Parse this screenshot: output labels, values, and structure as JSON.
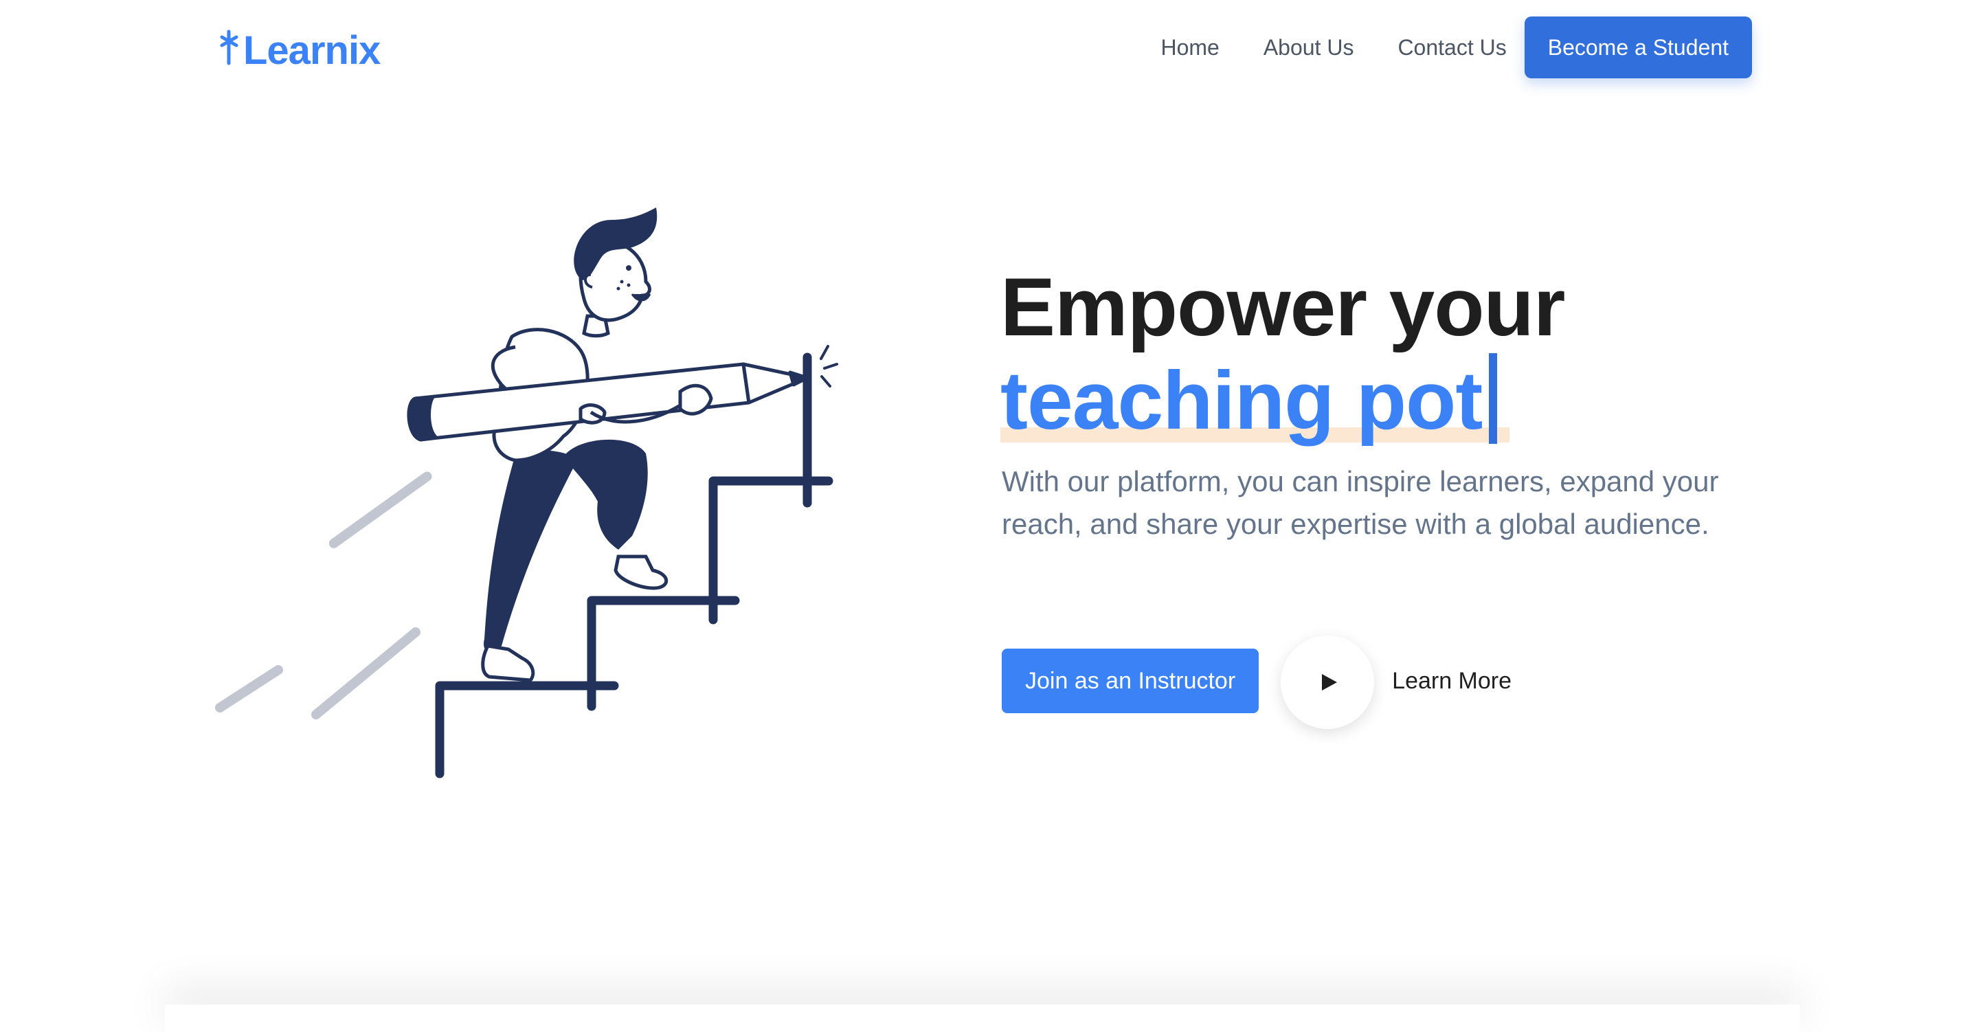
{
  "header": {
    "logo_text": "Learnix",
    "nav": [
      {
        "label": "Home"
      },
      {
        "label": "About Us"
      },
      {
        "label": "Contact Us"
      }
    ],
    "cta_label": "Become a Student"
  },
  "hero": {
    "title_line1": "Empower your",
    "title_line2_typed": "teaching pot",
    "description": "With our platform, you can inspire learners, expand your reach, and share your expertise with a global audience.",
    "primary_cta": "Join as an Instructor",
    "secondary_cta": "Learn More",
    "illustration_icon": "person-climbing-stairs-with-pencil"
  },
  "colors": {
    "brand": "#3b82f6",
    "brand_dark": "#3170dc",
    "heading": "#1f1f1f",
    "body_text": "#64748b",
    "navy": "#22325a",
    "highlight": "#fbe7d2"
  }
}
